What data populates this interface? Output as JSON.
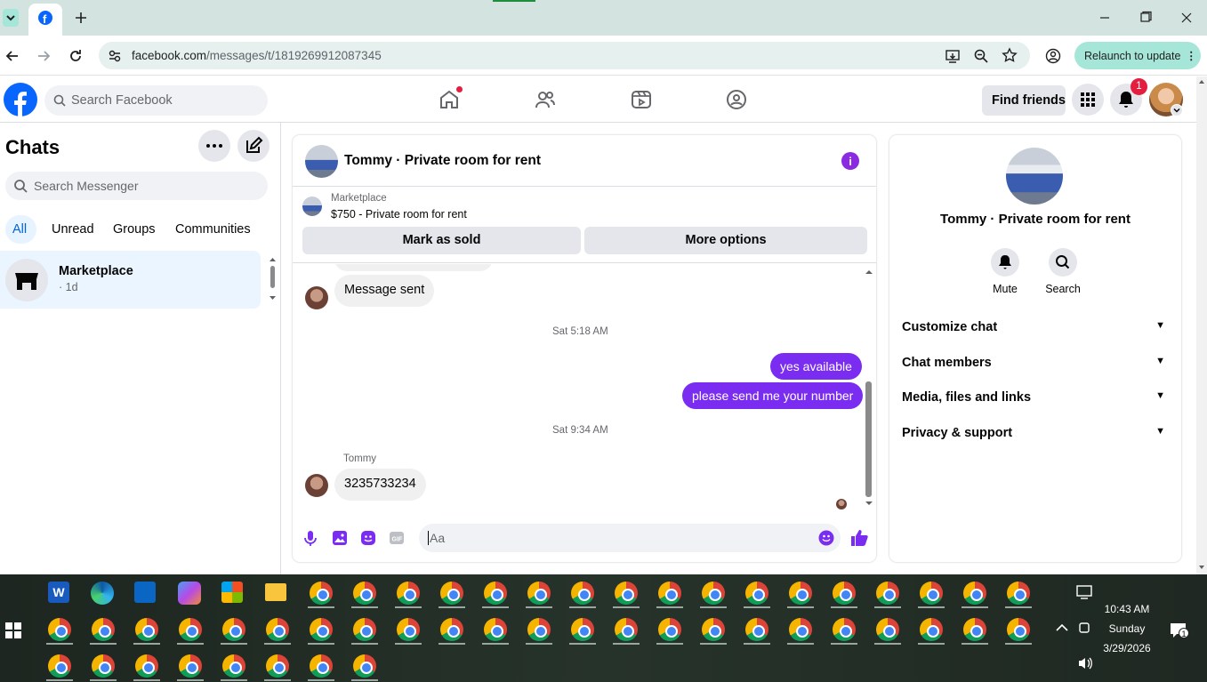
{
  "browser": {
    "url_host": "facebook.com",
    "url_path": "/messages/t/1819269912087345",
    "relaunch_label": "Relaunch to update"
  },
  "fb": {
    "search_placeholder": "Search Facebook",
    "find_friends": "Find friends",
    "notif_count": "1"
  },
  "left": {
    "title": "Chats",
    "search_placeholder": "Search Messenger",
    "filters": [
      "All",
      "Unread",
      "Groups",
      "Communities"
    ],
    "chat": {
      "name": "Marketplace",
      "meta": "· 1d"
    }
  },
  "conversation": {
    "title": "Tommy · Private room for rent",
    "listing": {
      "source": "Marketplace",
      "line": "$750 - Private room for rent"
    },
    "mark_sold": "Mark as sold",
    "more_options": "More options",
    "messages": {
      "m1": "Message sent",
      "stamp1": "Sat 5:18 AM",
      "o1": "yes available",
      "o2": "please send me your number",
      "stamp2": "Sat 9:34 AM",
      "sender": "Tommy",
      "m2": "3235733234"
    },
    "composer_placeholder": "Aa"
  },
  "right": {
    "title": "Tommy · Private room for rent",
    "mute": "Mute",
    "search": "Search",
    "sections": [
      "Customize chat",
      "Chat members",
      "Media, files and links",
      "Privacy & support"
    ]
  },
  "clock": {
    "time": "10:43 AM",
    "day": "Sunday",
    "date": "3/29/2026",
    "notif": "1"
  },
  "colors": {
    "fb_blue": "#0866ff",
    "msg_purple": "#7a2df0"
  }
}
